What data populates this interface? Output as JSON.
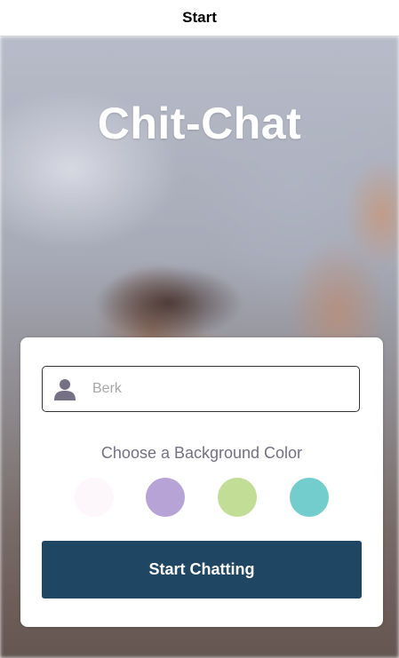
{
  "nav": {
    "title": "Start"
  },
  "app": {
    "title": "Chit-Chat"
  },
  "form": {
    "name_value": "",
    "name_placeholder": "Berk",
    "color_prompt": "Choose a Background Color",
    "colors": [
      "#fdf6fb",
      "#b8a3d6",
      "#c2dd95",
      "#73cdcd"
    ],
    "button_label": "Start Chatting"
  },
  "icons": {
    "name_field": "user-icon"
  }
}
